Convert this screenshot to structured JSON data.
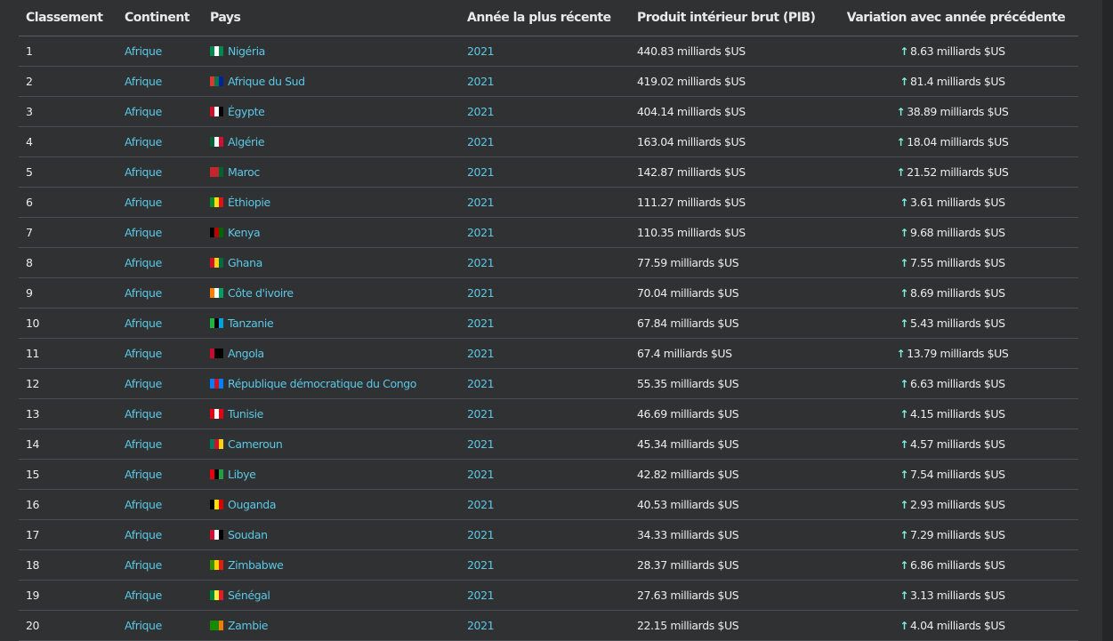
{
  "table": {
    "headers": [
      "Classement",
      "Continent",
      "Pays",
      "Année la plus récente",
      "Produit intérieur brut (PIB)",
      "Variation avec année précédente"
    ],
    "rows": [
      {
        "rank": "1",
        "continent": "Afrique",
        "country": "Nigéria",
        "year": "2021",
        "gdp": "440.83 milliards $US",
        "change": "8.63 milliards $US",
        "flag": [
          "#008751",
          "#ffffff",
          "#008751"
        ]
      },
      {
        "rank": "2",
        "continent": "Afrique",
        "country": "Afrique du Sud",
        "year": "2021",
        "gdp": "419.02 milliards $US",
        "change": "81.4 milliards $US",
        "flag": [
          "#de3831",
          "#007a4d",
          "#002395"
        ]
      },
      {
        "rank": "3",
        "continent": "Afrique",
        "country": "Égypte",
        "year": "2021",
        "gdp": "404.14 milliards $US",
        "change": "38.89 milliards $US",
        "flag": [
          "#ce1126",
          "#ffffff",
          "#000000"
        ]
      },
      {
        "rank": "4",
        "continent": "Afrique",
        "country": "Algérie",
        "year": "2021",
        "gdp": "163.04 milliards $US",
        "change": "18.04 milliards $US",
        "flag": [
          "#006233",
          "#ffffff",
          "#d21034"
        ]
      },
      {
        "rank": "5",
        "continent": "Afrique",
        "country": "Maroc",
        "year": "2021",
        "gdp": "142.87 milliards $US",
        "change": "21.52 milliards $US",
        "flag": [
          "#c1272d",
          "#c1272d",
          "#006233"
        ]
      },
      {
        "rank": "6",
        "continent": "Afrique",
        "country": "Éthiopie",
        "year": "2021",
        "gdp": "111.27 milliards $US",
        "change": "3.61 milliards $US",
        "flag": [
          "#078930",
          "#fcdd09",
          "#da121a"
        ]
      },
      {
        "rank": "7",
        "continent": "Afrique",
        "country": "Kenya",
        "year": "2021",
        "gdp": "110.35 milliards $US",
        "change": "9.68 milliards $US",
        "flag": [
          "#000000",
          "#bb0000",
          "#006600"
        ]
      },
      {
        "rank": "8",
        "continent": "Afrique",
        "country": "Ghana",
        "year": "2021",
        "gdp": "77.59 milliards $US",
        "change": "7.55 milliards $US",
        "flag": [
          "#ce1126",
          "#fcd116",
          "#006b3f"
        ]
      },
      {
        "rank": "9",
        "continent": "Afrique",
        "country": "Côte d'ivoire",
        "year": "2021",
        "gdp": "70.04 milliards $US",
        "change": "8.69 milliards $US",
        "flag": [
          "#f77f00",
          "#ffffff",
          "#009e60"
        ]
      },
      {
        "rank": "10",
        "continent": "Afrique",
        "country": "Tanzanie",
        "year": "2021",
        "gdp": "67.84 milliards $US",
        "change": "5.43 milliards $US",
        "flag": [
          "#1eb53a",
          "#000000",
          "#00a3dd"
        ]
      },
      {
        "rank": "11",
        "continent": "Afrique",
        "country": "Angola",
        "year": "2021",
        "gdp": "67.4 milliards $US",
        "change": "13.79 milliards $US",
        "flag": [
          "#cc092f",
          "#000000",
          "#000000"
        ]
      },
      {
        "rank": "12",
        "continent": "Afrique",
        "country": "République démocratique du Congo",
        "year": "2021",
        "gdp": "55.35 milliards $US",
        "change": "6.63 milliards $US",
        "flag": [
          "#007fff",
          "#ce1021",
          "#007fff"
        ]
      },
      {
        "rank": "13",
        "continent": "Afrique",
        "country": "Tunisie",
        "year": "2021",
        "gdp": "46.69 milliards $US",
        "change": "4.15 milliards $US",
        "flag": [
          "#e70013",
          "#ffffff",
          "#e70013"
        ]
      },
      {
        "rank": "14",
        "continent": "Afrique",
        "country": "Cameroun",
        "year": "2021",
        "gdp": "45.34 milliards $US",
        "change": "4.57 milliards $US",
        "flag": [
          "#007a5e",
          "#ce1126",
          "#fcd116"
        ]
      },
      {
        "rank": "15",
        "continent": "Afrique",
        "country": "Libye",
        "year": "2021",
        "gdp": "42.82 milliards $US",
        "change": "7.54 milliards $US",
        "flag": [
          "#e70013",
          "#000000",
          "#239e46"
        ]
      },
      {
        "rank": "16",
        "continent": "Afrique",
        "country": "Ouganda",
        "year": "2021",
        "gdp": "40.53 milliards $US",
        "change": "2.93 milliards $US",
        "flag": [
          "#000000",
          "#fcdc04",
          "#d90000"
        ]
      },
      {
        "rank": "17",
        "continent": "Afrique",
        "country": "Soudan",
        "year": "2021",
        "gdp": "34.33 milliards $US",
        "change": "7.29 milliards $US",
        "flag": [
          "#d21034",
          "#ffffff",
          "#000000"
        ]
      },
      {
        "rank": "18",
        "continent": "Afrique",
        "country": "Zimbabwe",
        "year": "2021",
        "gdp": "28.37 milliards $US",
        "change": "6.86 milliards $US",
        "flag": [
          "#319208",
          "#ffd200",
          "#de2010"
        ]
      },
      {
        "rank": "19",
        "continent": "Afrique",
        "country": "Sénégal",
        "year": "2021",
        "gdp": "27.63 milliards $US",
        "change": "3.13 milliards $US",
        "flag": [
          "#00853f",
          "#fdef42",
          "#e31b23"
        ]
      },
      {
        "rank": "20",
        "continent": "Afrique",
        "country": "Zambie",
        "year": "2021",
        "gdp": "22.15 milliards $US",
        "change": "4.04 milliards $US",
        "flag": [
          "#198a00",
          "#198a00",
          "#ef7d00"
        ]
      }
    ]
  },
  "icons": {
    "change_arrow": "arrow-up-icon",
    "flag": "country-flag-icon"
  },
  "colors": {
    "background": "#2f3133",
    "link": "#5bc8e6",
    "arrow": "#7ff0dc",
    "text": "#ececec"
  }
}
